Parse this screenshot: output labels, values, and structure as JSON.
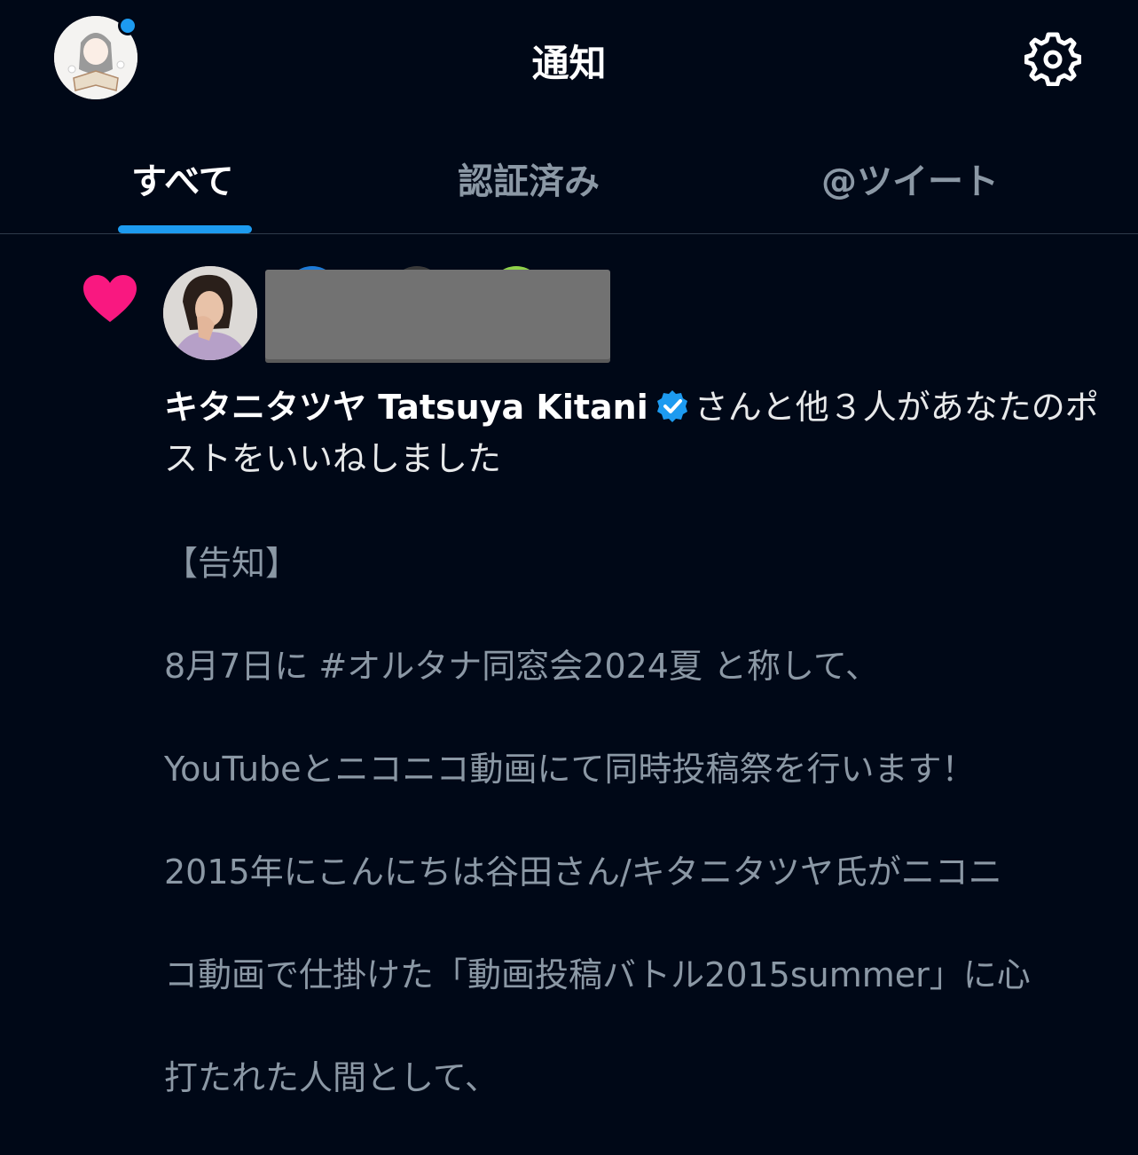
{
  "header": {
    "title": "通知",
    "avatar_icon": "user-avatar-anime",
    "settings_icon": "gear-icon",
    "accent": "#1d9bf0"
  },
  "tabs": [
    {
      "label": "すべて",
      "active": true
    },
    {
      "label": "認証済み",
      "active": false
    },
    {
      "label": "@ツイート",
      "active": false
    }
  ],
  "notification": {
    "type_icon": "heart-icon",
    "type_color": "#f91880",
    "user_name": "キタニタツヤ Tatsuya Kitani",
    "verified_icon": "verified-badge-icon",
    "action_text": "さんと他３人があなたのポストをいいねしました",
    "post_lines": [
      "【告知】",
      "8月7日に #オルタナ同窓会2024夏 と称して、",
      "YouTubeとニコニコ動画にて同時投稿祭を行います！",
      "2015年にこんにちは谷田さん/キタニタツヤ氏がニコニ",
      "コ動画で仕掛けた「動画投稿バトル2015summer」に心",
      "打たれた人間として、"
    ]
  }
}
